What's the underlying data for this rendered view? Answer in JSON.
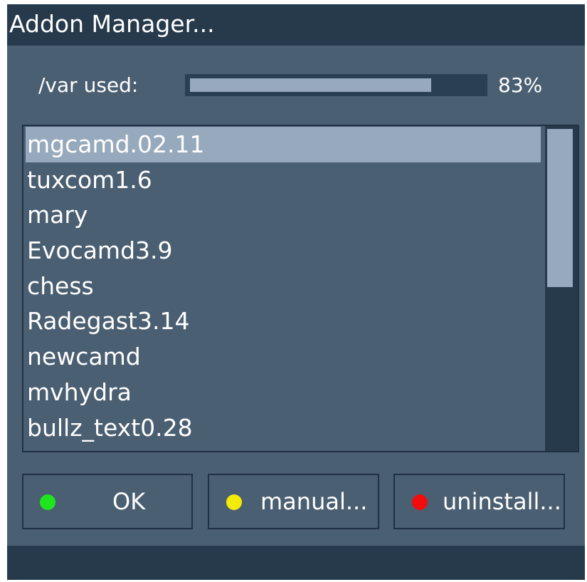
{
  "window": {
    "title": "Addon Manager..."
  },
  "usage": {
    "label": "/var used:",
    "percent_text": "83%",
    "fraction": 0.83
  },
  "addons": {
    "items": [
      "mgcamd.02.11",
      "tuxcom1.6",
      "mary",
      "Evocamd3.9",
      "chess",
      "Radegast3.14",
      "newcamd",
      "mvhydra",
      "bullz_text0.28"
    ],
    "selected_index": 0
  },
  "buttons": {
    "ok": {
      "label": "OK",
      "color": "#1ee61e",
      "icon": "green-dot-icon"
    },
    "manual": {
      "label": "manual...",
      "color": "#f4ea08",
      "icon": "yellow-dot-icon"
    },
    "uninstall": {
      "label": "uninstall...",
      "color": "#f20d0d",
      "icon": "red-dot-icon"
    }
  },
  "colors": {
    "panel": "#4b5f72",
    "dark": "#263a4c",
    "highlight": "#97a9bd",
    "text": "#ffffff"
  }
}
